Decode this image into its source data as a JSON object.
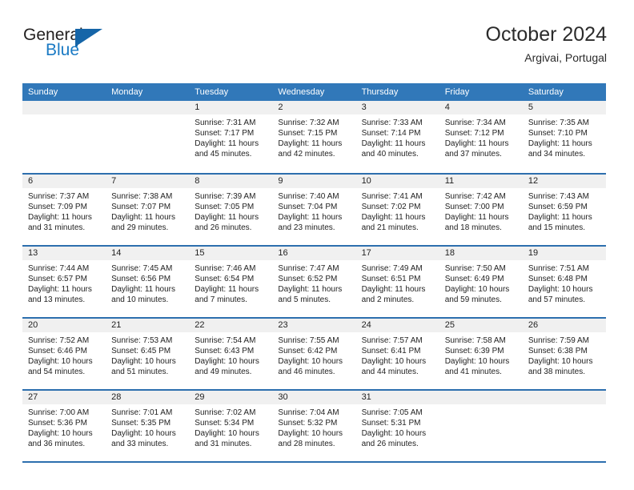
{
  "brand": {
    "word_general": "General",
    "word_blue": "Blue",
    "flag_color": "#1565a8",
    "blue_text_color": "#1a7ac4"
  },
  "header": {
    "title": "October 2024",
    "subtitle": "Argivai, Portugal",
    "accent_color": "#3178b9",
    "rule_color": "#2d6fae",
    "daynum_band_color": "#f0f0f0"
  },
  "weekdays": [
    "Sunday",
    "Monday",
    "Tuesday",
    "Wednesday",
    "Thursday",
    "Friday",
    "Saturday"
  ],
  "labels": {
    "sunrise_prefix": "Sunrise:",
    "sunset_prefix": "Sunset:",
    "daylight_prefix": "Daylight:"
  },
  "weeks": [
    {
      "days": [
        {
          "empty": true
        },
        {
          "empty": true
        },
        {
          "num": "1",
          "sunrise": "Sunrise: 7:31 AM",
          "sunset": "Sunset: 7:17 PM",
          "daylight_l1": "Daylight: 11 hours",
          "daylight_l2": "and 45 minutes."
        },
        {
          "num": "2",
          "sunrise": "Sunrise: 7:32 AM",
          "sunset": "Sunset: 7:15 PM",
          "daylight_l1": "Daylight: 11 hours",
          "daylight_l2": "and 42 minutes."
        },
        {
          "num": "3",
          "sunrise": "Sunrise: 7:33 AM",
          "sunset": "Sunset: 7:14 PM",
          "daylight_l1": "Daylight: 11 hours",
          "daylight_l2": "and 40 minutes."
        },
        {
          "num": "4",
          "sunrise": "Sunrise: 7:34 AM",
          "sunset": "Sunset: 7:12 PM",
          "daylight_l1": "Daylight: 11 hours",
          "daylight_l2": "and 37 minutes."
        },
        {
          "num": "5",
          "sunrise": "Sunrise: 7:35 AM",
          "sunset": "Sunset: 7:10 PM",
          "daylight_l1": "Daylight: 11 hours",
          "daylight_l2": "and 34 minutes."
        }
      ]
    },
    {
      "days": [
        {
          "num": "6",
          "sunrise": "Sunrise: 7:37 AM",
          "sunset": "Sunset: 7:09 PM",
          "daylight_l1": "Daylight: 11 hours",
          "daylight_l2": "and 31 minutes."
        },
        {
          "num": "7",
          "sunrise": "Sunrise: 7:38 AM",
          "sunset": "Sunset: 7:07 PM",
          "daylight_l1": "Daylight: 11 hours",
          "daylight_l2": "and 29 minutes."
        },
        {
          "num": "8",
          "sunrise": "Sunrise: 7:39 AM",
          "sunset": "Sunset: 7:05 PM",
          "daylight_l1": "Daylight: 11 hours",
          "daylight_l2": "and 26 minutes."
        },
        {
          "num": "9",
          "sunrise": "Sunrise: 7:40 AM",
          "sunset": "Sunset: 7:04 PM",
          "daylight_l1": "Daylight: 11 hours",
          "daylight_l2": "and 23 minutes."
        },
        {
          "num": "10",
          "sunrise": "Sunrise: 7:41 AM",
          "sunset": "Sunset: 7:02 PM",
          "daylight_l1": "Daylight: 11 hours",
          "daylight_l2": "and 21 minutes."
        },
        {
          "num": "11",
          "sunrise": "Sunrise: 7:42 AM",
          "sunset": "Sunset: 7:00 PM",
          "daylight_l1": "Daylight: 11 hours",
          "daylight_l2": "and 18 minutes."
        },
        {
          "num": "12",
          "sunrise": "Sunrise: 7:43 AM",
          "sunset": "Sunset: 6:59 PM",
          "daylight_l1": "Daylight: 11 hours",
          "daylight_l2": "and 15 minutes."
        }
      ]
    },
    {
      "days": [
        {
          "num": "13",
          "sunrise": "Sunrise: 7:44 AM",
          "sunset": "Sunset: 6:57 PM",
          "daylight_l1": "Daylight: 11 hours",
          "daylight_l2": "and 13 minutes."
        },
        {
          "num": "14",
          "sunrise": "Sunrise: 7:45 AM",
          "sunset": "Sunset: 6:56 PM",
          "daylight_l1": "Daylight: 11 hours",
          "daylight_l2": "and 10 minutes."
        },
        {
          "num": "15",
          "sunrise": "Sunrise: 7:46 AM",
          "sunset": "Sunset: 6:54 PM",
          "daylight_l1": "Daylight: 11 hours",
          "daylight_l2": "and 7 minutes."
        },
        {
          "num": "16",
          "sunrise": "Sunrise: 7:47 AM",
          "sunset": "Sunset: 6:52 PM",
          "daylight_l1": "Daylight: 11 hours",
          "daylight_l2": "and 5 minutes."
        },
        {
          "num": "17",
          "sunrise": "Sunrise: 7:49 AM",
          "sunset": "Sunset: 6:51 PM",
          "daylight_l1": "Daylight: 11 hours",
          "daylight_l2": "and 2 minutes."
        },
        {
          "num": "18",
          "sunrise": "Sunrise: 7:50 AM",
          "sunset": "Sunset: 6:49 PM",
          "daylight_l1": "Daylight: 10 hours",
          "daylight_l2": "and 59 minutes."
        },
        {
          "num": "19",
          "sunrise": "Sunrise: 7:51 AM",
          "sunset": "Sunset: 6:48 PM",
          "daylight_l1": "Daylight: 10 hours",
          "daylight_l2": "and 57 minutes."
        }
      ]
    },
    {
      "days": [
        {
          "num": "20",
          "sunrise": "Sunrise: 7:52 AM",
          "sunset": "Sunset: 6:46 PM",
          "daylight_l1": "Daylight: 10 hours",
          "daylight_l2": "and 54 minutes."
        },
        {
          "num": "21",
          "sunrise": "Sunrise: 7:53 AM",
          "sunset": "Sunset: 6:45 PM",
          "daylight_l1": "Daylight: 10 hours",
          "daylight_l2": "and 51 minutes."
        },
        {
          "num": "22",
          "sunrise": "Sunrise: 7:54 AM",
          "sunset": "Sunset: 6:43 PM",
          "daylight_l1": "Daylight: 10 hours",
          "daylight_l2": "and 49 minutes."
        },
        {
          "num": "23",
          "sunrise": "Sunrise: 7:55 AM",
          "sunset": "Sunset: 6:42 PM",
          "daylight_l1": "Daylight: 10 hours",
          "daylight_l2": "and 46 minutes."
        },
        {
          "num": "24",
          "sunrise": "Sunrise: 7:57 AM",
          "sunset": "Sunset: 6:41 PM",
          "daylight_l1": "Daylight: 10 hours",
          "daylight_l2": "and 44 minutes."
        },
        {
          "num": "25",
          "sunrise": "Sunrise: 7:58 AM",
          "sunset": "Sunset: 6:39 PM",
          "daylight_l1": "Daylight: 10 hours",
          "daylight_l2": "and 41 minutes."
        },
        {
          "num": "26",
          "sunrise": "Sunrise: 7:59 AM",
          "sunset": "Sunset: 6:38 PM",
          "daylight_l1": "Daylight: 10 hours",
          "daylight_l2": "and 38 minutes."
        }
      ]
    },
    {
      "days": [
        {
          "num": "27",
          "sunrise": "Sunrise: 7:00 AM",
          "sunset": "Sunset: 5:36 PM",
          "daylight_l1": "Daylight: 10 hours",
          "daylight_l2": "and 36 minutes."
        },
        {
          "num": "28",
          "sunrise": "Sunrise: 7:01 AM",
          "sunset": "Sunset: 5:35 PM",
          "daylight_l1": "Daylight: 10 hours",
          "daylight_l2": "and 33 minutes."
        },
        {
          "num": "29",
          "sunrise": "Sunrise: 7:02 AM",
          "sunset": "Sunset: 5:34 PM",
          "daylight_l1": "Daylight: 10 hours",
          "daylight_l2": "and 31 minutes."
        },
        {
          "num": "30",
          "sunrise": "Sunrise: 7:04 AM",
          "sunset": "Sunset: 5:32 PM",
          "daylight_l1": "Daylight: 10 hours",
          "daylight_l2": "and 28 minutes."
        },
        {
          "num": "31",
          "sunrise": "Sunrise: 7:05 AM",
          "sunset": "Sunset: 5:31 PM",
          "daylight_l1": "Daylight: 10 hours",
          "daylight_l2": "and 26 minutes."
        },
        {
          "empty": true
        },
        {
          "empty": true
        }
      ]
    }
  ]
}
